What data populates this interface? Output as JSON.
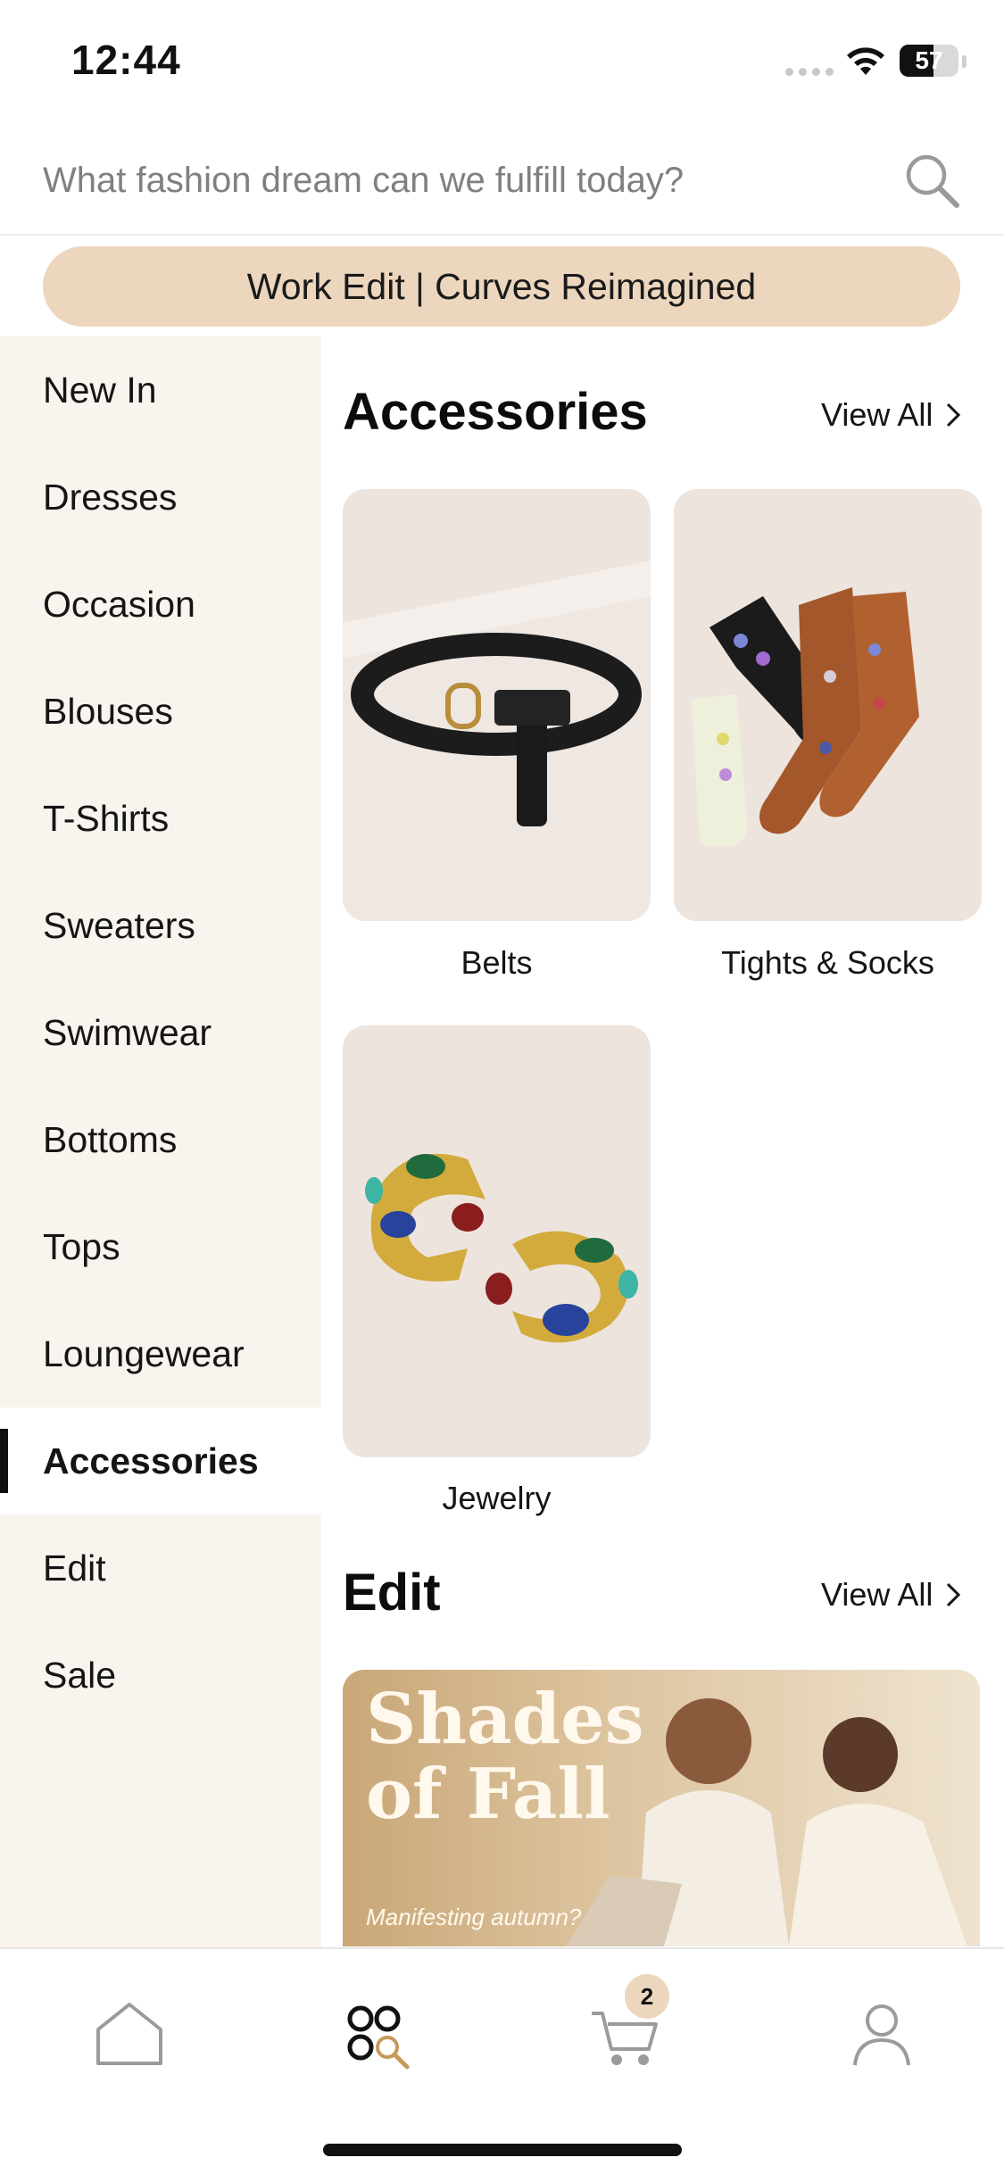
{
  "status_bar": {
    "time": "12:44",
    "battery": "57",
    "battery_level": 0.57
  },
  "search": {
    "placeholder": "What fashion dream can we fulfill today?"
  },
  "promo": {
    "label": "Work Edit | Curves Reimagined"
  },
  "sidebar": {
    "items": [
      {
        "label": "New In"
      },
      {
        "label": "Dresses"
      },
      {
        "label": "Occasion"
      },
      {
        "label": "Blouses"
      },
      {
        "label": "T-Shirts"
      },
      {
        "label": "Sweaters"
      },
      {
        "label": "Swimwear"
      },
      {
        "label": "Bottoms"
      },
      {
        "label": "Tops"
      },
      {
        "label": "Loungewear"
      },
      {
        "label": "Accessories",
        "active": true
      },
      {
        "label": "Edit"
      },
      {
        "label": "Sale"
      }
    ]
  },
  "accessories": {
    "title": "Accessories",
    "view_all": "View All",
    "items": [
      {
        "label": "Belts",
        "image": "black-belt-image"
      },
      {
        "label": "Tights & Socks",
        "image": "floral-socks-image"
      },
      {
        "label": "Jewelry",
        "image": "gemstone-hoop-earrings-image"
      }
    ]
  },
  "edit": {
    "title": "Edit",
    "view_all": "View All",
    "banner": {
      "title": "Shades\nof Fall",
      "subtitle": "Manifesting autumn?"
    }
  },
  "tab_bar": {
    "items": [
      {
        "icon": "home-icon"
      },
      {
        "icon": "categories-search-icon"
      },
      {
        "icon": "cart-icon"
      },
      {
        "icon": "profile-icon"
      }
    ],
    "cart_badge": "2"
  },
  "colors": {
    "accent": "#ecd6bd",
    "sidebar_bg": "#f9f4ee",
    "tile_bg": "#ede4de"
  }
}
